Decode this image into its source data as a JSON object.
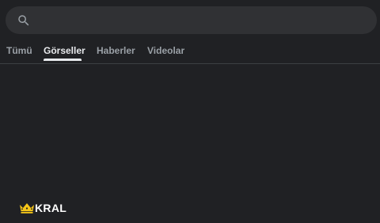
{
  "search": {
    "value": "",
    "placeholder": "",
    "icon": "search-icon"
  },
  "tabs": [
    {
      "label": "Tümü",
      "active": false
    },
    {
      "label": "Görseller",
      "active": true
    },
    {
      "label": "Haberler",
      "active": false
    },
    {
      "label": "Videolar",
      "active": false
    }
  ],
  "logo": {
    "text": "KRAL",
    "icon": "crown-icon",
    "crown_color": "#f5c518"
  },
  "colors": {
    "background": "#202124",
    "search_bar": "#303134",
    "tab_inactive": "#9aa0a6",
    "tab_active": "#e8eaed"
  }
}
